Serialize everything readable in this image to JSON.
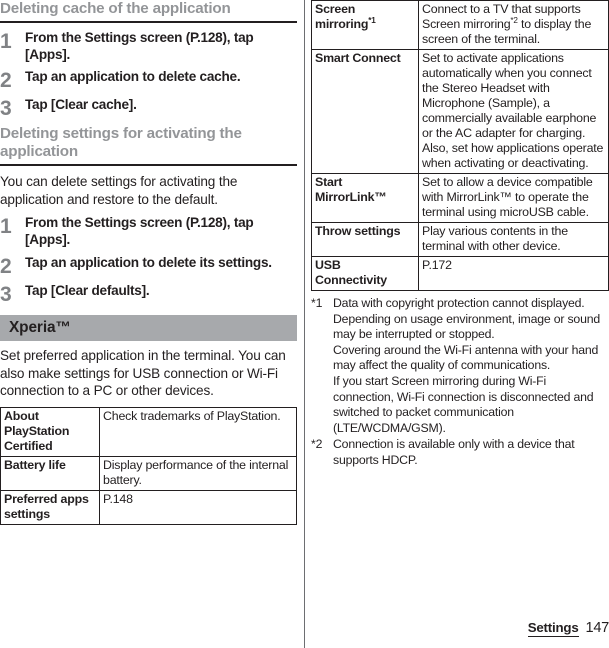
{
  "document": {
    "page_number": "147",
    "chapter_label": "Settings"
  },
  "left_column": {
    "section1": {
      "heading": "Deleting cache of the application",
      "steps": [
        {
          "num": "1",
          "text": "From the Settings screen (P.128), tap [Apps]."
        },
        {
          "num": "2",
          "text": "Tap an application to delete cache."
        },
        {
          "num": "3",
          "text": "Tap [Clear cache]."
        }
      ]
    },
    "section2": {
      "heading": "Deleting settings for activating the application",
      "intro": "You can delete settings for activating the application and restore to the default.",
      "steps": [
        {
          "num": "1",
          "text": "From the Settings screen (P.128), tap [Apps]."
        },
        {
          "num": "2",
          "text": "Tap an application to delete its settings."
        },
        {
          "num": "3",
          "text": "Tap [Clear defaults]."
        }
      ]
    },
    "chapter_bar": {
      "label": "Xperia™"
    },
    "intro": "Set preferred application in the terminal. You can also make settings for USB connection or Wi-Fi connection to a PC or other devices.",
    "table": {
      "rows": [
        {
          "key": "About PlayStation Certified",
          "value": "Check trademarks of PlayStation."
        },
        {
          "key": "Battery life",
          "value": "Display performance of the internal battery."
        },
        {
          "key": "Preferred apps settings",
          "value": "P.148"
        }
      ]
    }
  },
  "right_column": {
    "table": {
      "rows": [
        {
          "key": "Screen mirroring",
          "key_sup": "*1",
          "value_pre": "Connect to a TV that supports Screen mirroring",
          "value_sup": "*2",
          "value_post": " to display the screen of the terminal."
        },
        {
          "key": "Smart Connect",
          "value": "Set to activate applications automatically when you connect the Stereo Headset with Microphone (Sample), a commercially available earphone or the AC adapter for charging. Also, set how applications operate when activating or deactivating."
        },
        {
          "key": "Start MirrorLink™",
          "value": "Set to allow a device compatible with MirrorLink™ to operate the terminal using microUSB cable."
        },
        {
          "key": "Throw settings",
          "value": "Play various contents in the terminal with other device."
        },
        {
          "key": "USB Connectivity",
          "value": "P.172"
        }
      ]
    },
    "footnotes": [
      {
        "mark": "*1",
        "lines": [
          "Data with copyright protection cannot displayed. Depending on usage environment, image or sound may be interrupted or stopped.",
          "Covering around the Wi-Fi antenna with your hand may affect the quality of communications.",
          "If you start Screen mirroring during Wi-Fi connection, Wi-Fi connection is disconnected and switched to packet communication (LTE/WCDMA/GSM)."
        ]
      },
      {
        "mark": "*2",
        "lines": [
          "Connection is available only with a device that supports HDCP."
        ]
      }
    ]
  }
}
